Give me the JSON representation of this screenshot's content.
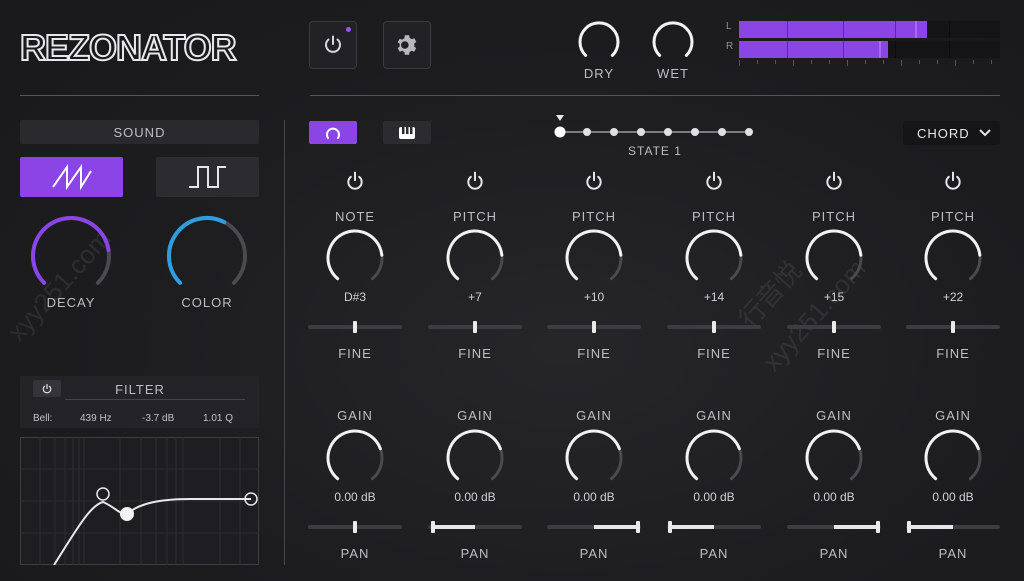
{
  "app": {
    "title": "REZONATOR"
  },
  "header": {
    "dry_label": "DRY",
    "wet_label": "WET",
    "meter_left": "L",
    "meter_right": "R",
    "meter_l_level": 0.72,
    "meter_r_level": 0.57
  },
  "sound": {
    "title": "SOUND",
    "decay_label": "DECAY",
    "color_label": "COLOR",
    "decay_value": 0.8,
    "color_value": 0.6
  },
  "filter": {
    "title": "FILTER",
    "type": "Bell:",
    "freq": "439 Hz",
    "gain": "-3.7 dB",
    "q": "1.01 Q"
  },
  "sequencer": {
    "state_label": "STATE  1",
    "mode_label": "CHORD",
    "steps": 8,
    "active_step": 1
  },
  "voices": [
    {
      "top_label": "NOTE",
      "value": "D#3",
      "fine_label": "FINE",
      "gain_label": "GAIN",
      "gain_value": "0.00 dB",
      "pan_label": "PAN",
      "fine": 0.5,
      "pan": 0.5
    },
    {
      "top_label": "PITCH",
      "value": "+7",
      "fine_label": "FINE",
      "gain_label": "GAIN",
      "gain_value": "0.00 dB",
      "pan_label": "PAN",
      "fine": 0.5,
      "pan": 0.05
    },
    {
      "top_label": "PITCH",
      "value": "+10",
      "fine_label": "FINE",
      "gain_label": "GAIN",
      "gain_value": "0.00 dB",
      "pan_label": "PAN",
      "fine": 0.5,
      "pan": 0.97
    },
    {
      "top_label": "PITCH",
      "value": "+14",
      "fine_label": "FINE",
      "gain_label": "GAIN",
      "gain_value": "0.00 dB",
      "pan_label": "PAN",
      "fine": 0.5,
      "pan": 0.03
    },
    {
      "top_label": "PITCH",
      "value": "+15",
      "fine_label": "FINE",
      "gain_label": "GAIN",
      "gain_value": "0.00 dB",
      "pan_label": "PAN",
      "fine": 0.5,
      "pan": 0.97
    },
    {
      "top_label": "PITCH",
      "value": "+22",
      "fine_label": "FINE",
      "gain_label": "GAIN",
      "gain_value": "0.00 dB",
      "pan_label": "PAN",
      "fine": 0.5,
      "pan": 0.03
    }
  ],
  "colors": {
    "accent": "#8b44e6",
    "blue": "#2f9de0",
    "knob_track": "#4a4a50",
    "knob_arc": "#f2f2f2"
  },
  "watermarks": [
    "xyy251.com",
    "行音悦",
    "xyy251.com"
  ]
}
